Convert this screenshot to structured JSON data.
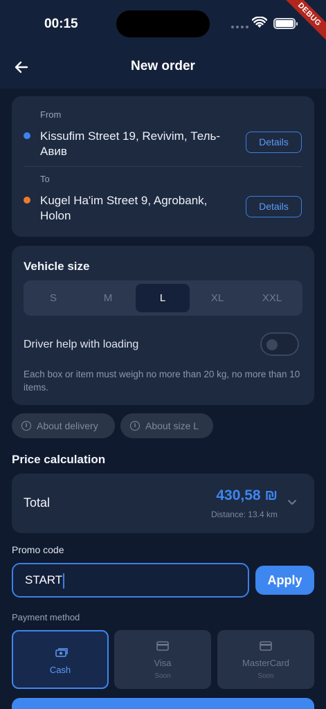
{
  "status_bar": {
    "time": "00:15",
    "debug_label": "DEBUG"
  },
  "app_bar": {
    "title": "New order"
  },
  "route": {
    "from_label": "From",
    "from_address": "Kissufim Street 19, Revivim, Тель-Авив",
    "to_label": "To",
    "to_address": "Kugel Ha'im Street 9, Agrobank, Holon",
    "details_label": "Details",
    "from_color": "#3d82f0",
    "to_color": "#f07a2a"
  },
  "vehicle": {
    "title": "Vehicle size",
    "sizes": [
      "S",
      "M",
      "L",
      "XL",
      "XXL"
    ],
    "selected": "L",
    "driver_help_label": "Driver help with loading",
    "driver_help_on": false,
    "note": "Each box or item must weigh no more than 20 kg, no more than 10 items."
  },
  "chips": {
    "about_delivery": "About delivery",
    "about_size": "About size L"
  },
  "price": {
    "section_title": "Price calculation",
    "total_label": "Total",
    "total_value": "430,58 ₪",
    "distance": "Distance: 13.4 km"
  },
  "promo": {
    "label": "Promo code",
    "value": "START",
    "apply_label": "Apply"
  },
  "payment": {
    "label": "Payment method",
    "methods": [
      {
        "name": "Cash",
        "sub": "",
        "icon": "cash-icon"
      },
      {
        "name": "Visa",
        "sub": "Soon",
        "icon": "card-icon"
      },
      {
        "name": "MasterCard",
        "sub": "Soon",
        "icon": "card-icon"
      }
    ],
    "selected": "Cash"
  },
  "colors": {
    "accent": "#3e86f0",
    "background": "#101a2e",
    "card": "#1d2a40"
  }
}
